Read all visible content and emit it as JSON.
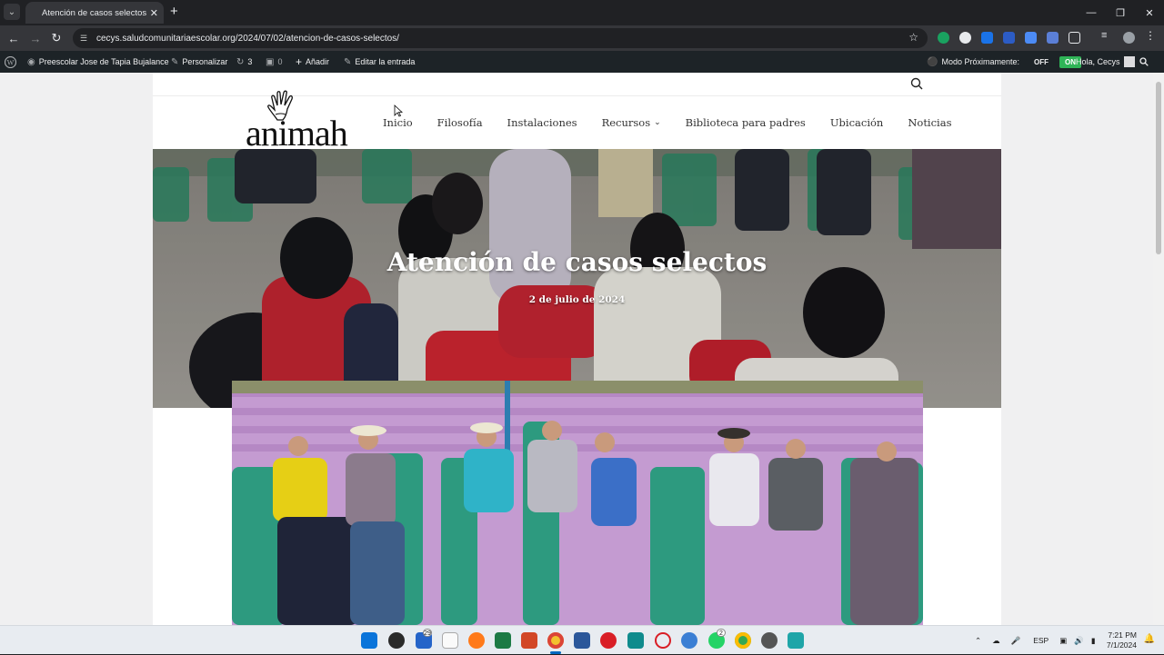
{
  "browser": {
    "tab_title": "Atención de casos selectos – Pr",
    "url": "cecys.saludcomunitariaescolar.org/2024/07/02/atencion-de-casos-selectos/"
  },
  "wp_admin_bar": {
    "site_name": "Preescolar Jose de Tapia Bujalance",
    "customize": "Personalizar",
    "updates_count": "3",
    "comments_count": "0",
    "add_new": "Añadir",
    "edit_post": "Editar la entrada",
    "coming_soon_label": "Modo Próximamente:",
    "toggle_off": "OFF",
    "toggle_on": "ON",
    "greeting": "Hola, Cecys"
  },
  "site": {
    "logo_text": "animah",
    "menu": [
      {
        "label": "Inicio"
      },
      {
        "label": "Filosofía"
      },
      {
        "label": "Instalaciones"
      },
      {
        "label": "Recursos"
      },
      {
        "label": "Biblioteca para padres"
      },
      {
        "label": "Ubicación"
      },
      {
        "label": "Noticias"
      }
    ]
  },
  "post": {
    "title": "Atención de casos selectos",
    "date": "2 de julio de 2024"
  },
  "taskbar": {
    "language": "ESP",
    "time": "7:21 PM",
    "date": "7/1/2024",
    "teams_badge": "29",
    "whatsapp_badge": "2"
  },
  "colors": {
    "wp_bar": "#1d2327",
    "toggle_on": "#2fb457",
    "chrome_dark": "#202124"
  }
}
